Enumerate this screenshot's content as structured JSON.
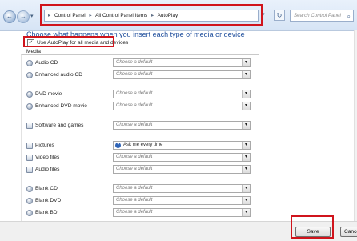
{
  "nav": {
    "back": "←",
    "forward": "→",
    "history": "▾",
    "refresh": "↻"
  },
  "address": {
    "crumbs": [
      "Control Panel",
      "All Control Panel Items",
      "AutoPlay"
    ],
    "separator": "▸",
    "dropdown": "▾"
  },
  "search": {
    "placeholder": "Search Control Panel",
    "icon": "⌕"
  },
  "heading": "Choose what happens when you insert each type of media or device",
  "autoplay_checkbox": {
    "label": "Use AutoPlay for all media and devices",
    "checked": true,
    "mark": "✓"
  },
  "media_section": "Media",
  "dropdown_arrow": "▾",
  "media_rows": [
    {
      "label": "Audio CD",
      "value": "Choose a default",
      "icon": "disc-icon"
    },
    {
      "label": "Enhanced audio CD",
      "value": "Choose a default",
      "icon": "disc-icon"
    },
    {
      "label": "DVD movie",
      "value": "Choose a default",
      "icon": "disc-icon"
    },
    {
      "label": "Enhanced DVD movie",
      "value": "Choose a default",
      "icon": "disc-icon"
    },
    {
      "label": "Software and games",
      "value": "Choose a default",
      "icon": "software-icon"
    },
    {
      "label": "Pictures",
      "value": "Ask me every time",
      "icon": "pictures-icon",
      "question_mark": "?"
    },
    {
      "label": "Video files",
      "value": "Choose a default",
      "icon": "video-icon"
    },
    {
      "label": "Audio files",
      "value": "Choose a default",
      "icon": "audio-file-icon"
    },
    {
      "label": "Blank CD",
      "value": "Choose a default",
      "icon": "disc-icon"
    },
    {
      "label": "Blank DVD",
      "value": "Choose a default",
      "icon": "disc-icon"
    },
    {
      "label": "Blank BD",
      "value": "Choose a default",
      "icon": "disc-icon"
    }
  ],
  "buttons": {
    "save": "Save",
    "cancel": "Cancel"
  },
  "colors": {
    "heading": "#1f4e9c",
    "highlight": "#d0141c"
  }
}
